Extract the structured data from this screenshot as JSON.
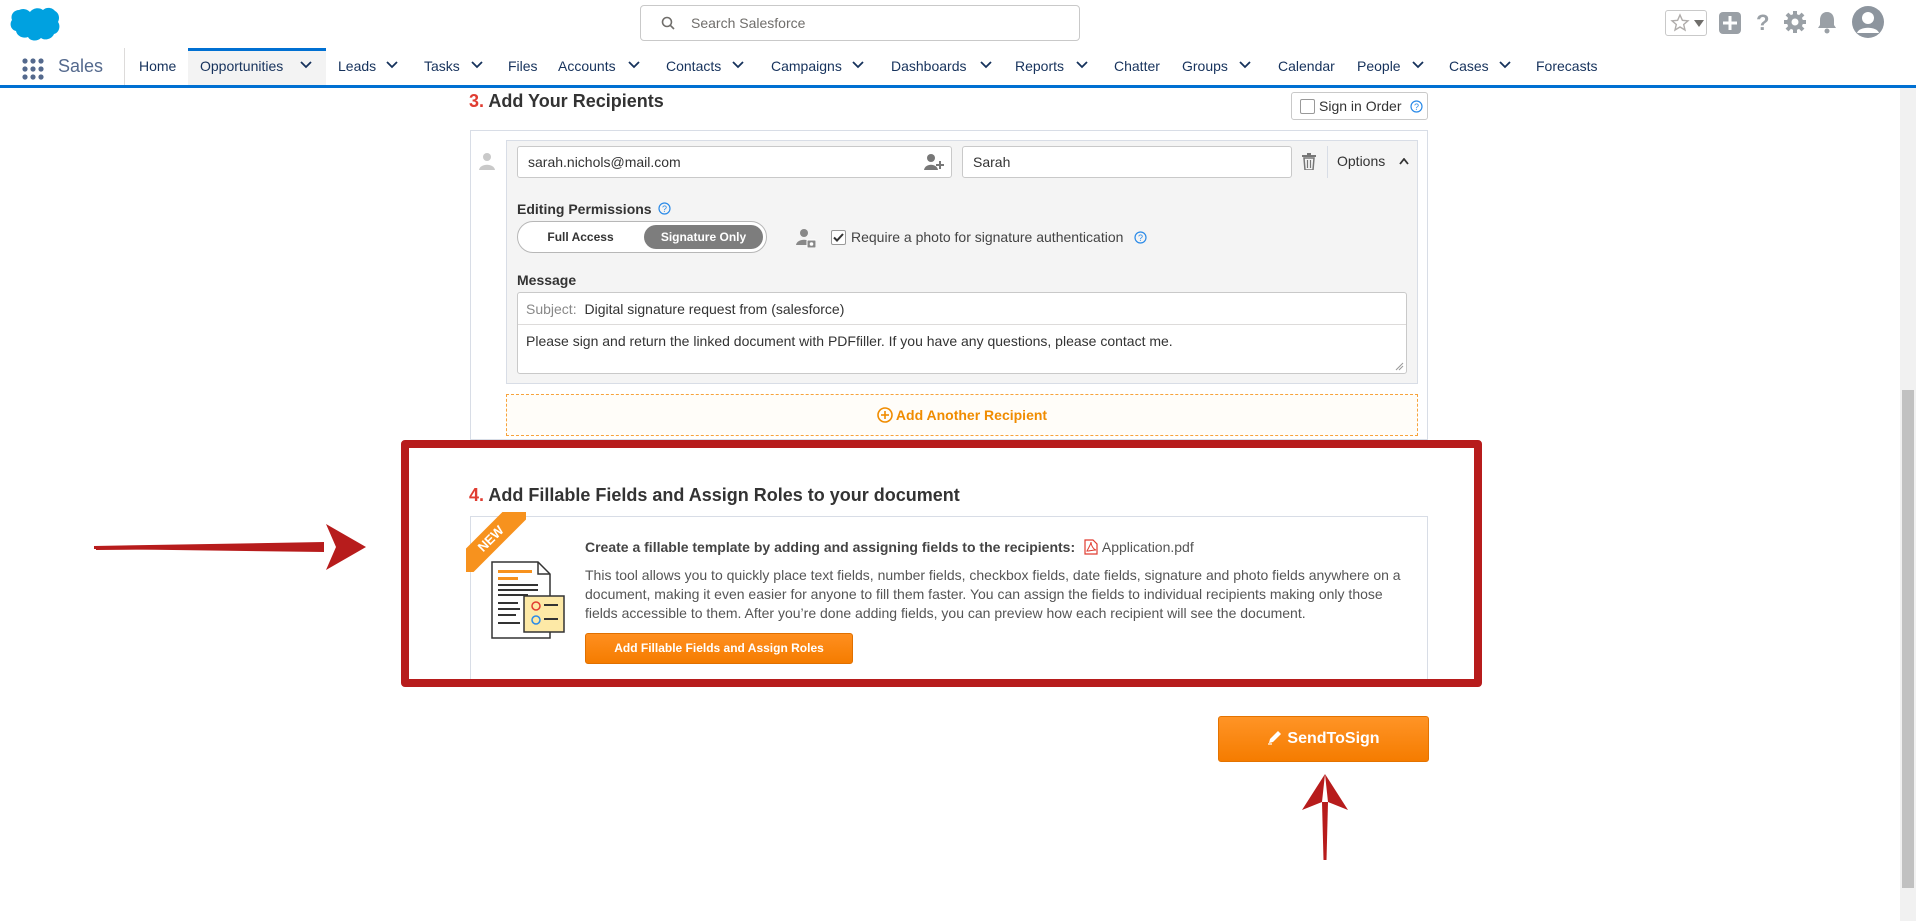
{
  "header": {
    "search_placeholder": "Search Salesforce",
    "brand_color": "#00a1e0"
  },
  "nav": {
    "app_name": "Sales",
    "tabs": [
      {
        "label": "Home"
      },
      {
        "label": "Opportunities"
      },
      {
        "label": "Leads"
      },
      {
        "label": "Tasks"
      },
      {
        "label": "Files"
      },
      {
        "label": "Accounts"
      },
      {
        "label": "Contacts"
      },
      {
        "label": "Campaigns"
      },
      {
        "label": "Dashboards"
      },
      {
        "label": "Reports"
      },
      {
        "label": "Chatter"
      },
      {
        "label": "Groups"
      },
      {
        "label": "Calendar"
      },
      {
        "label": "People"
      },
      {
        "label": "Cases"
      },
      {
        "label": "Forecasts"
      }
    ],
    "active_tab": "Opportunities"
  },
  "recipients": {
    "step_number": "3.",
    "title": "Add Your Recipients",
    "sign_in_order_label": "Sign in Order",
    "email": "sarah.nichols@mail.com",
    "name": "Sarah",
    "options_label": "Options",
    "editing_permissions_label": "Editing Permissions",
    "permission_options": [
      "Full Access",
      "Signature Only"
    ],
    "selected_permission": "Signature Only",
    "photo_auth_label": "Require a photo for signature authentication",
    "photo_auth_checked": true,
    "message_label": "Message",
    "subject_label": "Subject:",
    "subject_value": "Digital signature request from  (salesforce)",
    "message_body": "Please sign and return the linked document with PDFfiller. If you have any questions, please contact me.",
    "add_another_label": "Add Another Recipient"
  },
  "fillable": {
    "step_number": "4.",
    "title": "Add Fillable Fields and Assign Roles to your document",
    "badge": "NEW",
    "heading": "Create a fillable template by adding and assigning fields to the recipients:",
    "file_name": "Application.pdf",
    "description": "This tool allows you to quickly place text fields, number fields, checkbox fields, date fields, signature and photo fields anywhere on a document, making it even easier for anyone to fill them faster. You can assign the fields to individual recipients making only those fields accessible to them. After you’re done adding fields, you can preview how each recipient will see the document.",
    "button_label": "Add Fillable Fields and Assign Roles"
  },
  "send_button_label": "SendToSign",
  "colors": {
    "accent_blue": "#0070d2",
    "orange": "#f57c00",
    "annotation_red": "#b71c1c",
    "step_red": "#e03c31"
  }
}
